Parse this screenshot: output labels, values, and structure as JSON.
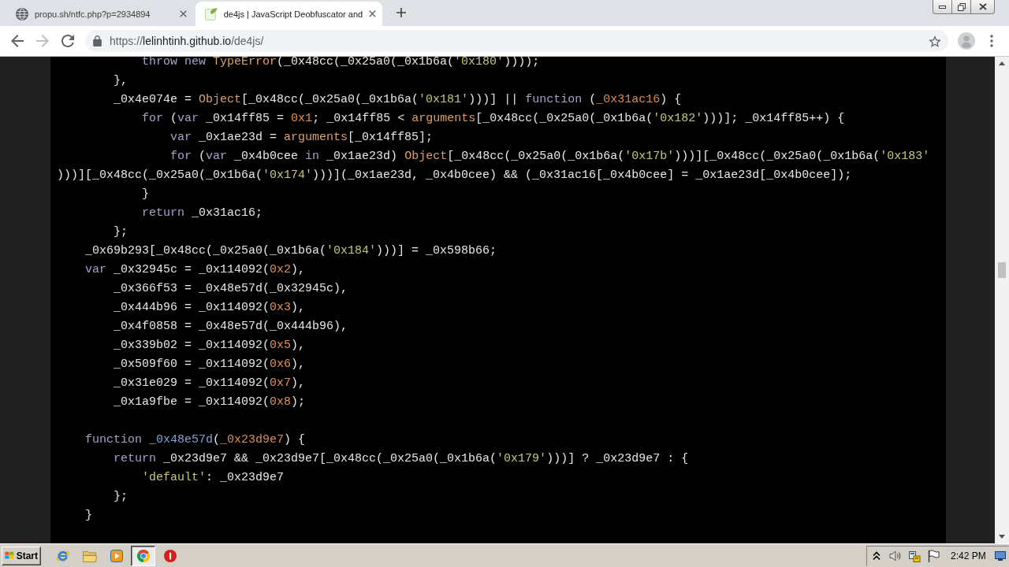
{
  "browser": {
    "tabs": [
      {
        "kind": "globe",
        "title": "propu.sh/ntfc.php?p=2934894",
        "selected": false
      },
      {
        "kind": "page",
        "title": "de4js | JavaScript Deobfuscator and",
        "selected": true
      }
    ],
    "nav_buttons": [
      {
        "kind": "back",
        "disabled": false
      },
      {
        "kind": "forward",
        "disabled": true
      },
      {
        "kind": "reload",
        "disabled": false
      }
    ],
    "address": {
      "scheme": "https://",
      "host": "lelinhtinh.github.io",
      "path": "/de4js/"
    }
  },
  "editor": {
    "blocks": [
      {
        "lines": [
          {
            "tokens": [
              {
                "kind": "keyword",
                "text": "            throw new "
              },
              {
                "kind": "builtin",
                "text": "TypeError"
              },
              {
                "kind": "plain",
                "text": "(_0x48cc(_0x25a0(_0x1b6a("
              },
              {
                "kind": "string",
                "text": "'0x180'"
              },
              {
                "kind": "plain",
                "text": "))));"
              }
            ]
          },
          {
            "tokens": [
              {
                "kind": "plain",
                "text": "        },"
              }
            ]
          },
          {
            "tokens": [
              {
                "kind": "plain",
                "text": "        _0x4e074e = "
              },
              {
                "kind": "builtin",
                "text": "Object"
              },
              {
                "kind": "plain",
                "text": "[_0x48cc(_0x25a0(_0x1b6a("
              },
              {
                "kind": "string",
                "text": "'0x181'"
              },
              {
                "kind": "plain",
                "text": ")))] || "
              },
              {
                "kind": "keyword",
                "text": "function "
              },
              {
                "kind": "plain",
                "text": "("
              },
              {
                "kind": "param",
                "text": "_0x31ac16"
              },
              {
                "kind": "plain",
                "text": ") {"
              }
            ]
          },
          {
            "tokens": [
              {
                "kind": "keyword",
                "text": "            for "
              },
              {
                "kind": "plain",
                "text": "("
              },
              {
                "kind": "keyword",
                "text": "var "
              },
              {
                "kind": "plain",
                "text": "_0x14ff85 = "
              },
              {
                "kind": "number",
                "text": "0x1"
              },
              {
                "kind": "plain",
                "text": "; _0x14ff85 < "
              },
              {
                "kind": "builtin",
                "text": "arguments"
              },
              {
                "kind": "plain",
                "text": "[_0x48cc(_0x25a0(_0x1b6a("
              },
              {
                "kind": "string",
                "text": "'0x182'"
              },
              {
                "kind": "plain",
                "text": ")))]; _0x14ff85++) {"
              }
            ]
          },
          {
            "tokens": [
              {
                "kind": "keyword",
                "text": "                var "
              },
              {
                "kind": "plain",
                "text": "_0x1ae23d = "
              },
              {
                "kind": "builtin",
                "text": "arguments"
              },
              {
                "kind": "plain",
                "text": "[_0x14ff85];"
              }
            ]
          },
          {
            "tokens": [
              {
                "kind": "keyword",
                "text": "                for "
              },
              {
                "kind": "plain",
                "text": "("
              },
              {
                "kind": "keyword",
                "text": "var "
              },
              {
                "kind": "plain",
                "text": "_0x4b0cee "
              },
              {
                "kind": "keyword",
                "text": "in "
              },
              {
                "kind": "plain",
                "text": "_0x1ae23d) "
              },
              {
                "kind": "builtin",
                "text": "Object"
              },
              {
                "kind": "plain",
                "text": "[_0x48cc(_0x25a0(_0x1b6a("
              },
              {
                "kind": "string",
                "text": "'0x17b'"
              },
              {
                "kind": "plain",
                "text": ")))][_0x48cc(_0x25a0(_0x1b6a("
              },
              {
                "kind": "string",
                "text": "'0x183'"
              }
            ]
          },
          {
            "tokens": [
              {
                "kind": "plain",
                "text": ")))][_0x48cc(_0x25a0(_0x1b6a("
              },
              {
                "kind": "string",
                "text": "'0x174'"
              },
              {
                "kind": "plain",
                "text": ")))](_0x1ae23d, _0x4b0cee) && (_0x31ac16[_0x4b0cee] = _0x1ae23d[_0x4b0cee]);"
              }
            ]
          },
          {
            "tokens": [
              {
                "kind": "plain",
                "text": "            }"
              }
            ]
          },
          {
            "tokens": [
              {
                "kind": "keyword",
                "text": "            return "
              },
              {
                "kind": "plain",
                "text": "_0x31ac16;"
              }
            ]
          },
          {
            "tokens": [
              {
                "kind": "plain",
                "text": "        };"
              }
            ]
          },
          {
            "tokens": [
              {
                "kind": "plain",
                "text": "    _0x69b293[_0x48cc(_0x25a0(_0x1b6a("
              },
              {
                "kind": "string",
                "text": "'0x184'"
              },
              {
                "kind": "plain",
                "text": ")))] = _0x598b66;"
              }
            ]
          },
          {
            "tokens": [
              {
                "kind": "keyword",
                "text": "    var "
              },
              {
                "kind": "plain",
                "text": "_0x32945c = _0x114092("
              },
              {
                "kind": "number",
                "text": "0x2"
              },
              {
                "kind": "plain",
                "text": "),"
              }
            ]
          },
          {
            "tokens": [
              {
                "kind": "plain",
                "text": "        _0x366f53 = _0x48e57d(_0x32945c),"
              }
            ]
          },
          {
            "tokens": [
              {
                "kind": "plain",
                "text": "        _0x444b96 = _0x114092("
              },
              {
                "kind": "number",
                "text": "0x3"
              },
              {
                "kind": "plain",
                "text": "),"
              }
            ]
          },
          {
            "tokens": [
              {
                "kind": "plain",
                "text": "        _0x4f0858 = _0x48e57d(_0x444b96),"
              }
            ]
          },
          {
            "tokens": [
              {
                "kind": "plain",
                "text": "        _0x339b02 = _0x114092("
              },
              {
                "kind": "number",
                "text": "0x5"
              },
              {
                "kind": "plain",
                "text": "),"
              }
            ]
          },
          {
            "tokens": [
              {
                "kind": "plain",
                "text": "        _0x509f60 = _0x114092("
              },
              {
                "kind": "number",
                "text": "0x6"
              },
              {
                "kind": "plain",
                "text": "),"
              }
            ]
          },
          {
            "tokens": [
              {
                "kind": "plain",
                "text": "        _0x31e029 = _0x114092("
              },
              {
                "kind": "number",
                "text": "0x7"
              },
              {
                "kind": "plain",
                "text": "),"
              }
            ]
          },
          {
            "tokens": [
              {
                "kind": "plain",
                "text": "        _0x1a9fbe = _0x114092("
              },
              {
                "kind": "number",
                "text": "0x8"
              },
              {
                "kind": "plain",
                "text": ");"
              }
            ]
          }
        ]
      },
      {
        "lines": [
          {
            "tokens": [
              {
                "kind": "keyword",
                "text": "    function "
              },
              {
                "kind": "function",
                "text": "_0x48e57d"
              },
              {
                "kind": "plain",
                "text": "("
              },
              {
                "kind": "param",
                "text": "_0x23d9e7"
              },
              {
                "kind": "plain",
                "text": ") {"
              }
            ]
          },
          {
            "tokens": [
              {
                "kind": "keyword",
                "text": "        return "
              },
              {
                "kind": "plain",
                "text": "_0x23d9e7 && _0x23d9e7[_0x48cc(_0x25a0(_0x1b6a("
              },
              {
                "kind": "string",
                "text": "'0x179'"
              },
              {
                "kind": "plain",
                "text": ")))] ? _0x23d9e7 : {"
              }
            ]
          },
          {
            "tokens": [
              {
                "kind": "string",
                "text": "            'default'"
              },
              {
                "kind": "plain",
                "text": ": _0x23d9e7"
              }
            ]
          },
          {
            "tokens": [
              {
                "kind": "plain",
                "text": "        };"
              }
            ]
          },
          {
            "tokens": [
              {
                "kind": "plain",
                "text": "    }"
              }
            ]
          }
        ]
      }
    ]
  },
  "taskbar": {
    "start_label": "Start",
    "items": [
      {
        "kind": "ie",
        "selected": false
      },
      {
        "kind": "folder",
        "selected": false
      },
      {
        "kind": "media",
        "selected": false
      },
      {
        "kind": "chrome",
        "selected": true
      },
      {
        "kind": "alert",
        "selected": false
      }
    ],
    "clock": "2:42 PM"
  }
}
